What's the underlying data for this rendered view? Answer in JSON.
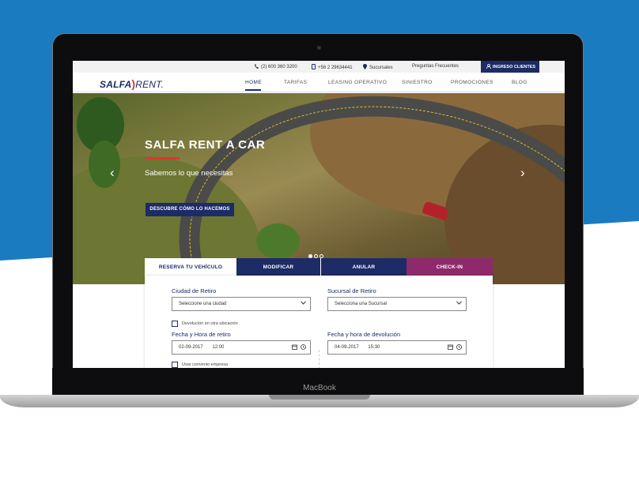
{
  "topbar": {
    "phone1": "(2) 600 360 3200",
    "phone2": "+56 2 29634441",
    "branches": "Sucursales",
    "faq": "Preguntas Frecuentes",
    "login": "INGRESO CLIENTES"
  },
  "logo": {
    "part1": "SALFA",
    "part2": "RENT."
  },
  "nav": {
    "items": [
      "HOME",
      "TARIFAS",
      "LEASING OPERATIVO",
      "SINIESTRO",
      "PROMOCIONES",
      "BLOG"
    ]
  },
  "hero": {
    "title": "SALFA RENT A CAR",
    "subtitle": "Sabemos lo que necesitas",
    "cta": "DESCUBRE CÓMO LO HACEMOS"
  },
  "tabs": [
    "RESERVA TU VEHÍCULO",
    "MODIFICAR",
    "ANULAR",
    "CHECK-IN"
  ],
  "form": {
    "city_label": "Ciudad de Retiro",
    "city_value": "Seleccione una ciudad",
    "branch_label": "Sucursal de Retiro",
    "branch_value": "Selecciona una Sucursal",
    "return_other": "Devolución en otra ubicación",
    "pickup_label": "Fecha y Hora de retiro",
    "pickup_date": "02-09-2017",
    "pickup_time": "12:00",
    "return_label": "Fecha y hora de devolución",
    "return_date": "04-09-2017",
    "return_time": "15:30",
    "agreement": "Usar convenio empresa"
  },
  "device": {
    "label": "MacBook"
  },
  "colors": {
    "brand_navy": "#1d2b66",
    "accent_red": "#e3342f",
    "checkin_purple": "#8e2a6b",
    "background_blue": "#1b7bc0"
  }
}
